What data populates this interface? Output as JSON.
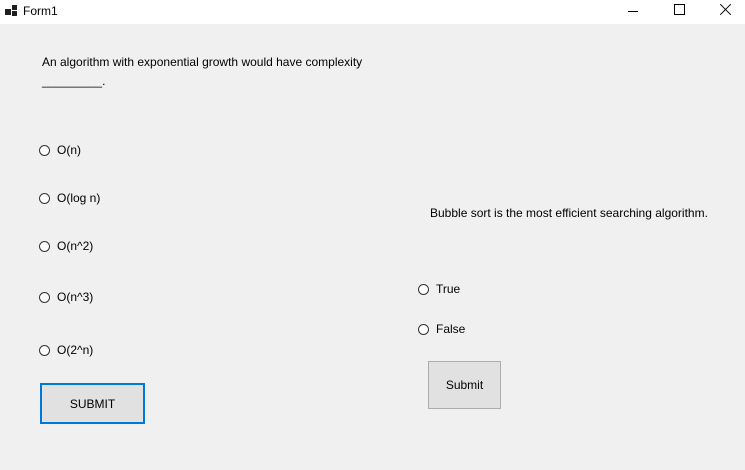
{
  "window": {
    "title": "Form1"
  },
  "question1": {
    "text_line1": "An algorithm with exponential growth would have complexity",
    "text_line2": "_________.",
    "options": [
      "O(n)",
      "O(log n)",
      "O(n^2)",
      "O(n^3)",
      "O(2^n)"
    ],
    "submit_label": "SUBMIT"
  },
  "question2": {
    "text": "Bubble sort is the most efficient searching algorithm.",
    "options": [
      "True",
      "False"
    ],
    "submit_label": "Submit"
  },
  "icons": [
    "app-icon",
    "minimize-icon",
    "maximize-icon",
    "close-icon"
  ]
}
